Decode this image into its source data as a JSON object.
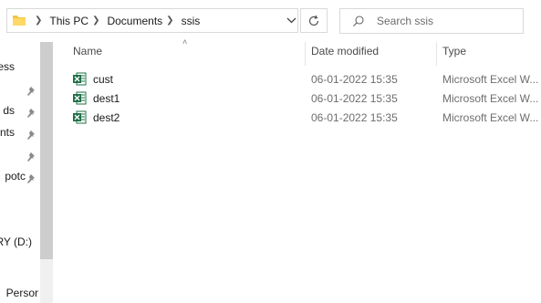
{
  "address_bar": {
    "breadcrumbs": [
      "This PC",
      "Documents",
      "ssis"
    ]
  },
  "search": {
    "placeholder": "Search ssis"
  },
  "nav_pane": {
    "items": [
      {
        "label": "ess",
        "pinned": false
      },
      {
        "label": "",
        "pinned": true
      },
      {
        "label": "ds",
        "pinned": true
      },
      {
        "label": "nts",
        "pinned": true
      },
      {
        "label": "",
        "pinned": true
      },
      {
        "label": "potc",
        "pinned": true
      },
      {
        "label": "RY (D:)",
        "pinned": false
      },
      {
        "label": "Persor",
        "pinned": false
      }
    ]
  },
  "columns": {
    "name": "Name",
    "date_modified": "Date modified",
    "type": "Type"
  },
  "files": [
    {
      "name": "cust",
      "date": "06-01-2022 15:35",
      "type": "Microsoft Excel W..."
    },
    {
      "name": "dest1",
      "date": "06-01-2022 15:35",
      "type": "Microsoft Excel W..."
    },
    {
      "name": "dest2",
      "date": "06-01-2022 15:35",
      "type": "Microsoft Excel W..."
    }
  ],
  "colors": {
    "excel_green": "#1d7044",
    "folder_yellow": "#f5c342",
    "border": "#d9d9d9"
  }
}
